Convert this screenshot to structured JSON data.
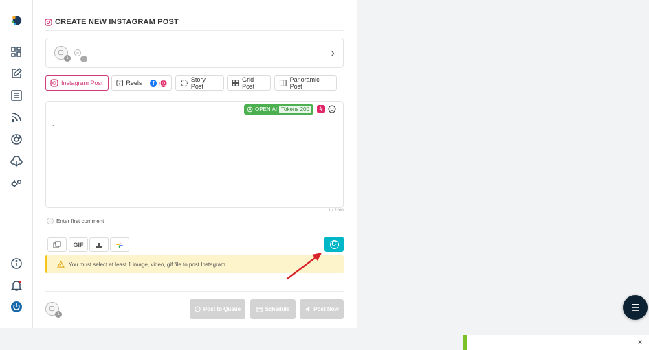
{
  "page": {
    "title": "CREATE NEW INSTAGRAM POST"
  },
  "sidebar": {
    "items": [
      {
        "icon": "logo-icon"
      },
      {
        "icon": "dashboard-icon"
      },
      {
        "icon": "compose-icon"
      },
      {
        "icon": "posts-list-icon"
      },
      {
        "icon": "rss-icon"
      },
      {
        "icon": "analytics-icon"
      },
      {
        "icon": "download-icon"
      },
      {
        "icon": "settings-icon"
      },
      {
        "icon": "info-icon"
      },
      {
        "icon": "bell-icon"
      },
      {
        "icon": "power-icon"
      }
    ]
  },
  "accounts": {
    "badge": "1"
  },
  "tabs": [
    {
      "label": "Instagram Post",
      "icon": "instagram-icon",
      "active": true
    },
    {
      "label": "Reels",
      "icon": "reels-icon",
      "active": false
    },
    {
      "label": "Story Post",
      "icon": "story-icon",
      "active": false
    },
    {
      "label": "Grid Post",
      "icon": "grid-icon",
      "active": false
    },
    {
      "label": "Panoramic Post",
      "icon": "panoramic-icon",
      "active": false
    }
  ],
  "editor": {
    "value": ".",
    "openai_label": "OPEN AI",
    "tokens_label": "Tokens",
    "tokens_value": "200",
    "counter": "1 / 2200"
  },
  "comment": {
    "placeholder": "Enter first comment"
  },
  "media": {
    "gif_label": "GIF"
  },
  "warning": {
    "text": "You must select at least 1 image, video, gif file to post Instagram."
  },
  "footer": {
    "badge": "1",
    "post_to_queue": "Post to Queue",
    "schedule": "Schedule",
    "post_now": "Post Now"
  },
  "toast": {
    "close": "×"
  },
  "colors": {
    "accent": "#d23b7a",
    "openai": "#4cb050",
    "canva": "#00b7c7",
    "warning_bg": "#fdf4cc",
    "fab": "#0c2233",
    "toast_border": "#7cc12a",
    "arrow": "#d9242c"
  }
}
